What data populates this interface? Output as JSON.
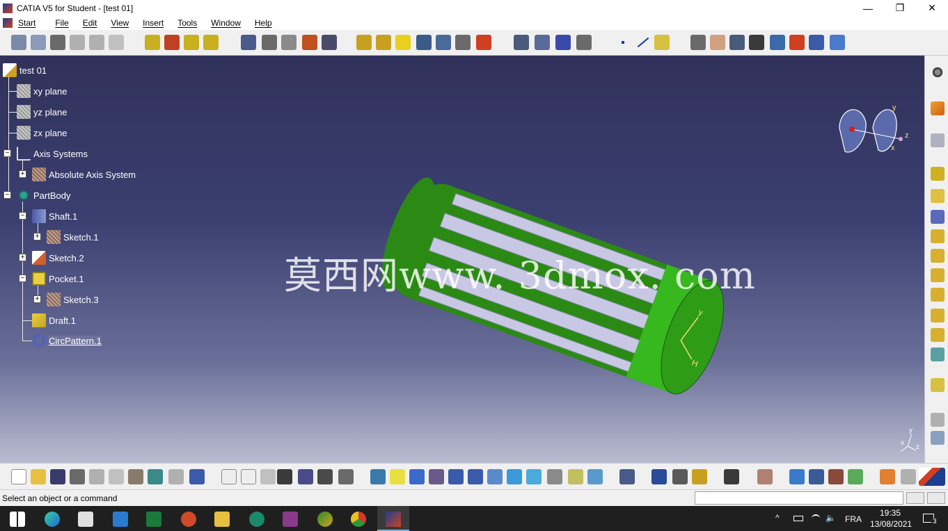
{
  "window": {
    "title": "CATIA V5 for Student - [test 01]"
  },
  "menubar": {
    "items": [
      "Start",
      "File",
      "Edit",
      "View",
      "Insert",
      "Tools",
      "Window",
      "Help"
    ]
  },
  "tree": {
    "root": "test 01",
    "nodes": [
      {
        "label": "xy plane"
      },
      {
        "label": "yz plane"
      },
      {
        "label": "zx plane"
      },
      {
        "label": "Axis Systems"
      },
      {
        "label": "Absolute Axis System"
      },
      {
        "label": "PartBody"
      },
      {
        "label": "Shaft.1"
      },
      {
        "label": "Sketch.1"
      },
      {
        "label": "Sketch.2"
      },
      {
        "label": "Pocket.1"
      },
      {
        "label": "Sketch.3"
      },
      {
        "label": "Draft.1"
      },
      {
        "label": "CircPattern.1"
      }
    ]
  },
  "watermark": "莫西网www. 3dmox. com",
  "model": {
    "color": "#2b8a14",
    "axis_y": "y",
    "axis_h": "H"
  },
  "compass": {
    "y": "y",
    "z": "z",
    "x": "x"
  },
  "triad": {
    "y": "y",
    "x": "x",
    "z": "z"
  },
  "status": {
    "prompt": "Select an object or a command"
  },
  "taskbar": {
    "language": "FRA",
    "time": "19:35",
    "date": "13/08/2021",
    "notifications": "3"
  },
  "colors": {
    "tree_text": "#ffffff",
    "viewport_top": "#30325a",
    "viewport_bottom": "#b9bcd0"
  }
}
